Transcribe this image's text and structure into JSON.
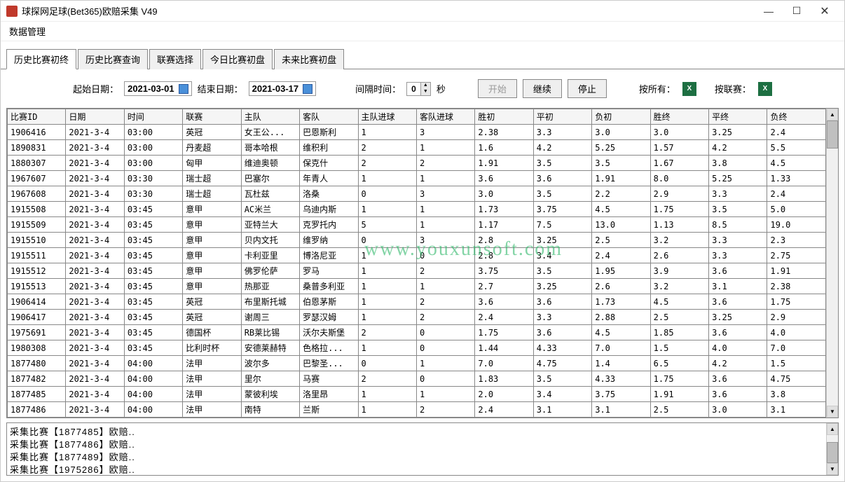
{
  "window": {
    "title": "球探网足球(Bet365)欧赔采集 V49"
  },
  "menu": {
    "data_mgmt": "数据管理"
  },
  "tabs": [
    "历史比赛初终",
    "历史比赛查询",
    "联赛选择",
    "今日比赛初盘",
    "未来比赛初盘"
  ],
  "controls": {
    "start_date_label": "起始日期：",
    "start_date": "2021-03-01",
    "end_date_label": "结束日期：",
    "end_date": "2021-03-17",
    "interval_label": "间隔时间：",
    "interval_value": "0",
    "interval_unit": "秒",
    "btn_start": "开始",
    "btn_continue": "继续",
    "btn_stop": "停止",
    "btn_by_all": "按所有：",
    "btn_by_league": "按联赛："
  },
  "columns": [
    "比赛ID",
    "日期",
    "时间",
    "联赛",
    "主队",
    "客队",
    "主队进球",
    "客队进球",
    "胜初",
    "平初",
    "负初",
    "胜终",
    "平终",
    "负终"
  ],
  "rows": [
    [
      "1906416",
      "2021-3-4",
      "03:00",
      "英冠",
      "女王公...",
      "巴恩斯利",
      "1",
      "3",
      "2.38",
      "3.3",
      "3.0",
      "3.0",
      "3.25",
      "2.4"
    ],
    [
      "1890831",
      "2021-3-4",
      "03:00",
      "丹麦超",
      "哥本哈根",
      "维积利",
      "2",
      "1",
      "1.6",
      "4.2",
      "5.25",
      "1.57",
      "4.2",
      "5.5"
    ],
    [
      "1880307",
      "2021-3-4",
      "03:00",
      "匈甲",
      "维迪奥顿",
      "保克什",
      "2",
      "2",
      "1.91",
      "3.5",
      "3.5",
      "1.67",
      "3.8",
      "4.5"
    ],
    [
      "1967607",
      "2021-3-4",
      "03:30",
      "瑞士超",
      "巴塞尔",
      "年青人",
      "1",
      "1",
      "3.6",
      "3.6",
      "1.91",
      "8.0",
      "5.25",
      "1.33"
    ],
    [
      "1967608",
      "2021-3-4",
      "03:30",
      "瑞士超",
      "瓦杜兹",
      "洛桑",
      "0",
      "3",
      "3.0",
      "3.5",
      "2.2",
      "2.9",
      "3.3",
      "2.4"
    ],
    [
      "1915508",
      "2021-3-4",
      "03:45",
      "意甲",
      "AC米兰",
      "乌迪内斯",
      "1",
      "1",
      "1.73",
      "3.75",
      "4.5",
      "1.75",
      "3.5",
      "5.0"
    ],
    [
      "1915509",
      "2021-3-4",
      "03:45",
      "意甲",
      "亚特兰大",
      "克罗托内",
      "5",
      "1",
      "1.17",
      "7.5",
      "13.0",
      "1.13",
      "8.5",
      "19.0"
    ],
    [
      "1915510",
      "2021-3-4",
      "03:45",
      "意甲",
      "贝内文托",
      "维罗纳",
      "0",
      "3",
      "2.8",
      "3.25",
      "2.5",
      "3.2",
      "3.3",
      "2.3"
    ],
    [
      "1915511",
      "2021-3-4",
      "03:45",
      "意甲",
      "卡利亚里",
      "博洛尼亚",
      "1",
      "0",
      "2.8",
      "3.4",
      "2.4",
      "2.6",
      "3.3",
      "2.75"
    ],
    [
      "1915512",
      "2021-3-4",
      "03:45",
      "意甲",
      "佛罗伦萨",
      "罗马",
      "1",
      "2",
      "3.75",
      "3.5",
      "1.95",
      "3.9",
      "3.6",
      "1.91"
    ],
    [
      "1915513",
      "2021-3-4",
      "03:45",
      "意甲",
      "热那亚",
      "桑普多利亚",
      "1",
      "1",
      "2.7",
      "3.25",
      "2.6",
      "3.2",
      "3.1",
      "2.38"
    ],
    [
      "1906414",
      "2021-3-4",
      "03:45",
      "英冠",
      "布里斯托城",
      "伯恩茅斯",
      "1",
      "2",
      "3.6",
      "3.6",
      "1.73",
      "4.5",
      "3.6",
      "1.75"
    ],
    [
      "1906417",
      "2021-3-4",
      "03:45",
      "英冠",
      "谢周三",
      "罗瑟汉姆",
      "1",
      "2",
      "2.4",
      "3.3",
      "2.88",
      "2.5",
      "3.25",
      "2.9"
    ],
    [
      "1975691",
      "2021-3-4",
      "03:45",
      "德国杯",
      "RB莱比锡",
      "沃尔夫斯堡",
      "2",
      "0",
      "1.75",
      "3.6",
      "4.5",
      "1.85",
      "3.6",
      "4.0"
    ],
    [
      "1980308",
      "2021-3-4",
      "03:45",
      "比利时杯",
      "安德莱赫特",
      "色格拉...",
      "1",
      "0",
      "1.44",
      "4.33",
      "7.0",
      "1.5",
      "4.0",
      "7.0"
    ],
    [
      "1877480",
      "2021-3-4",
      "04:00",
      "法甲",
      "波尔多",
      "巴黎圣...",
      "0",
      "1",
      "7.0",
      "4.75",
      "1.4",
      "6.5",
      "4.2",
      "1.5"
    ],
    [
      "1877482",
      "2021-3-4",
      "04:00",
      "法甲",
      "里尔",
      "马赛",
      "2",
      "0",
      "1.83",
      "3.5",
      "4.33",
      "1.75",
      "3.6",
      "4.75"
    ],
    [
      "1877485",
      "2021-3-4",
      "04:00",
      "法甲",
      "蒙彼利埃",
      "洛里昂",
      "1",
      "1",
      "2.0",
      "3.4",
      "3.75",
      "1.91",
      "3.6",
      "3.8"
    ],
    [
      "1877486",
      "2021-3-4",
      "04:00",
      "法甲",
      "南特",
      "兰斯",
      "1",
      "2",
      "2.4",
      "3.1",
      "3.1",
      "2.5",
      "3.0",
      "3.1"
    ]
  ],
  "log": [
    "采集比赛【1877485】欧赔..",
    "采集比赛【1877486】欧赔..",
    "采集比赛【1877489】欧赔..",
    "采集比赛【1975286】欧赔.."
  ],
  "watermark": "www.youxunsoft.com"
}
